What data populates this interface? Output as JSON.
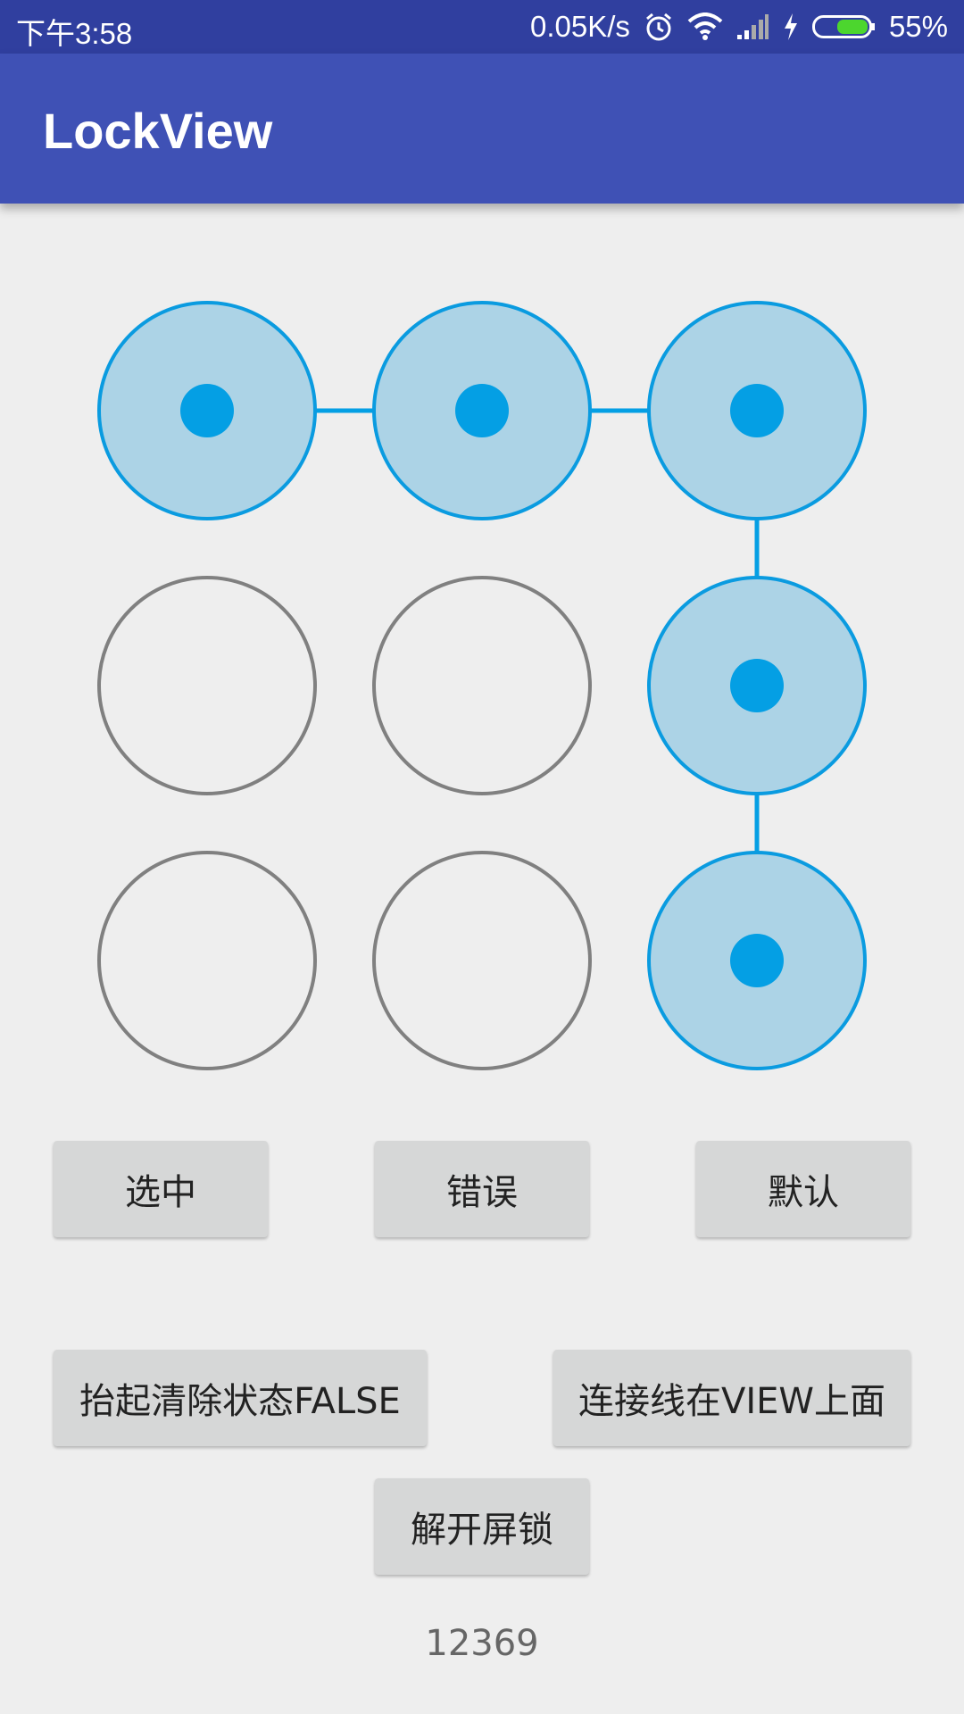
{
  "status_bar": {
    "time": "下午3:58",
    "net_speed": "0.05K/s",
    "battery": "55%",
    "icons": [
      "alarm-icon",
      "wifi-icon",
      "signal-icon",
      "charging-icon",
      "battery-icon"
    ]
  },
  "app_bar": {
    "title": "LockView"
  },
  "lock_pattern": {
    "grid_size": 3,
    "selected_nodes": [
      1,
      2,
      3,
      6,
      9
    ],
    "colors": {
      "selected_stroke": "#0a9be0",
      "selected_fill": "#acd3e6",
      "selected_dot": "#049fe4",
      "line": "#049fe4",
      "default_stroke": "#808080"
    }
  },
  "buttons": {
    "selected": "选中",
    "error": "错误",
    "default": "默认",
    "clear_state": "抬起清除状态FALSE",
    "line_above": "连接线在VIEW上面",
    "unlock": "解开屏锁"
  },
  "password": "12369"
}
